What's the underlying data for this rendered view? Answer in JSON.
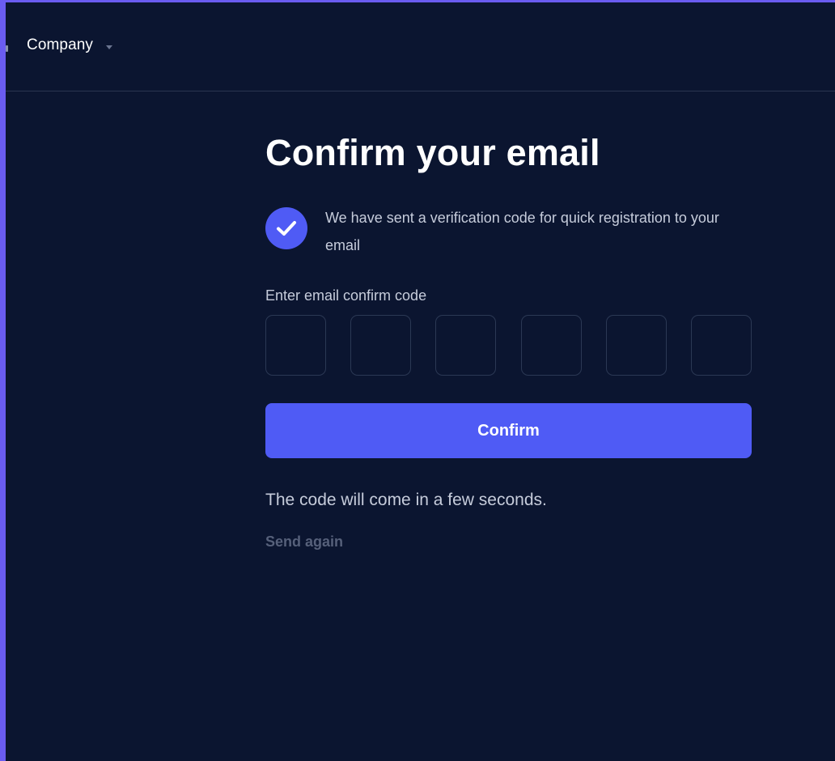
{
  "colors": {
    "background": "#0b1530",
    "accent": "#4f5bf5",
    "frame": "#6a5cf0",
    "text_primary": "#ffffff",
    "text_secondary": "#c6ccdb",
    "text_muted": "#56607a",
    "input_border": "#2b3854"
  },
  "header": {
    "company_label": "Company",
    "caret_icon": "caret-down-icon"
  },
  "main": {
    "title": "Confirm your email",
    "notice": {
      "icon": "check-circle-icon",
      "text": "We have sent a verification code for quick registration to your email"
    },
    "code_label": "Enter email confirm code",
    "code_fields": [
      {
        "value": ""
      },
      {
        "value": ""
      },
      {
        "value": ""
      },
      {
        "value": ""
      },
      {
        "value": ""
      },
      {
        "value": ""
      }
    ],
    "confirm_label": "Confirm",
    "hint": "The code will come in a few seconds.",
    "send_again_label": "Send again"
  }
}
